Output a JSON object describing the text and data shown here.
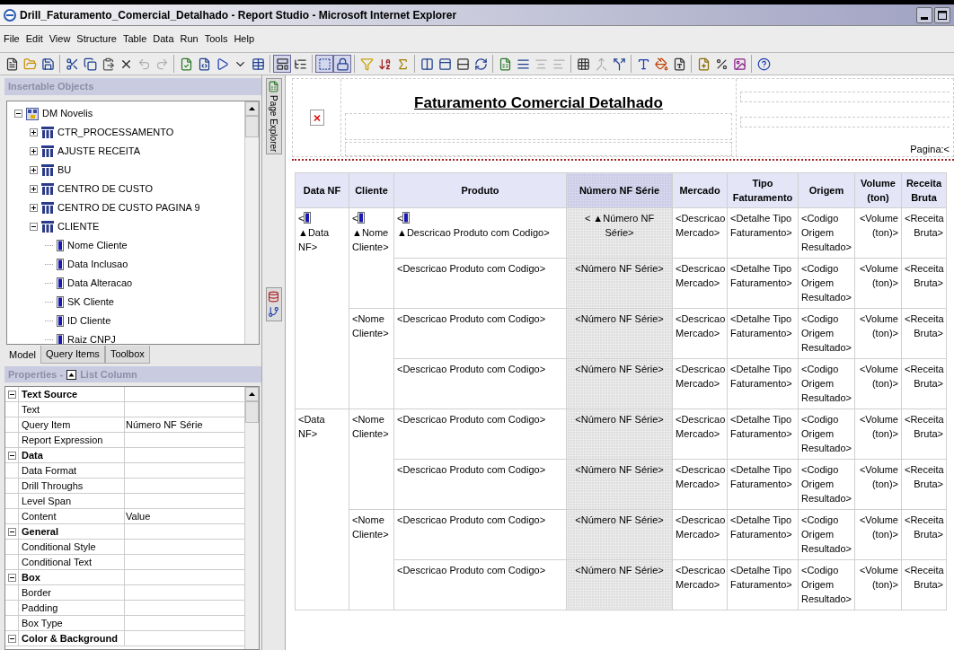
{
  "window": {
    "title": "Drill_Faturamento_Comercial_Detalhado - Report Studio - Microsoft Internet Explorer"
  },
  "menu": [
    "File",
    "Edit",
    "View",
    "Structure",
    "Table",
    "Data",
    "Run",
    "Tools",
    "Help"
  ],
  "toolbar": [
    [
      {
        "pressed": false,
        "disabled": false
      },
      {
        "pressed": false,
        "disabled": false
      },
      {
        "pressed": false,
        "disabled": false
      }
    ],
    [
      {
        "pressed": false,
        "disabled": false
      },
      {
        "pressed": false,
        "disabled": false
      },
      {
        "pressed": false,
        "disabled": false
      },
      {
        "pressed": false,
        "disabled": false
      },
      {
        "pressed": false,
        "disabled": true
      },
      {
        "pressed": false,
        "disabled": true
      }
    ],
    [
      {
        "pressed": false,
        "disabled": false
      },
      {
        "pressed": false,
        "disabled": false
      },
      {
        "pressed": false,
        "disabled": false
      },
      {
        "pressed": false,
        "disabled": false
      },
      {
        "pressed": false,
        "disabled": false
      }
    ],
    [
      {
        "pressed": true,
        "disabled": false
      },
      {
        "pressed": false,
        "disabled": false
      }
    ],
    [
      {
        "pressed": true,
        "disabled": false
      },
      {
        "pressed": true,
        "disabled": false
      }
    ],
    [
      {
        "pressed": false,
        "disabled": false
      },
      {
        "pressed": false,
        "disabled": false
      },
      {
        "pressed": false,
        "disabled": false
      }
    ],
    [
      {
        "pressed": false,
        "disabled": false
      },
      {
        "pressed": false,
        "disabled": false
      },
      {
        "pressed": false,
        "disabled": false
      },
      {
        "pressed": false,
        "disabled": false
      }
    ],
    [
      {
        "pressed": false,
        "disabled": false
      },
      {
        "pressed": false,
        "disabled": false
      },
      {
        "pressed": false,
        "disabled": true
      },
      {
        "pressed": false,
        "disabled": true
      }
    ],
    [
      {
        "pressed": false,
        "disabled": false
      },
      {
        "pressed": false,
        "disabled": true
      },
      {
        "pressed": false,
        "disabled": false
      }
    ],
    [
      {
        "pressed": false,
        "disabled": false
      },
      {
        "pressed": false,
        "disabled": false
      },
      {
        "pressed": false,
        "disabled": false
      }
    ],
    [
      {
        "pressed": false,
        "disabled": false
      },
      {
        "pressed": false,
        "disabled": false
      },
      {
        "pressed": false,
        "disabled": false
      }
    ],
    [
      {
        "pressed": false,
        "disabled": false
      }
    ]
  ],
  "insertable_objects": {
    "title": "Insertable Objects",
    "tree": [
      {
        "label": "DM Novelis",
        "kind": "package",
        "expanded": true,
        "children": [
          {
            "label": "CTR_PROCESSAMENTO",
            "kind": "query_subject",
            "expanded": false
          },
          {
            "label": "AJUSTE RECEITA",
            "kind": "query_subject",
            "expanded": false
          },
          {
            "label": "BU",
            "kind": "query_subject",
            "expanded": false
          },
          {
            "label": "CENTRO DE CUSTO",
            "kind": "query_subject",
            "expanded": false
          },
          {
            "label": "CENTRO DE CUSTO PAGINA 9",
            "kind": "query_subject",
            "expanded": false
          },
          {
            "label": "CLIENTE",
            "kind": "query_subject",
            "expanded": true,
            "children": [
              {
                "label": "Nome Cliente",
                "kind": "query_item"
              },
              {
                "label": "Data Inclusao",
                "kind": "query_item"
              },
              {
                "label": "Data Alteracao",
                "kind": "query_item"
              },
              {
                "label": "SK Cliente",
                "kind": "query_item"
              },
              {
                "label": "ID Cliente",
                "kind": "query_item"
              },
              {
                "label": "Raiz CNPJ",
                "kind": "query_item"
              }
            ]
          }
        ]
      }
    ]
  },
  "tabs": [
    {
      "label": "Model",
      "selected": true
    },
    {
      "label": "Query Items",
      "selected": false
    },
    {
      "label": "Toolbox",
      "selected": false
    }
  ],
  "properties": {
    "title": "Properties -",
    "object": "List Column",
    "groups": [
      {
        "name": "Text Source",
        "expanded": true,
        "rows": [
          {
            "name": "Text"
          },
          {
            "name": "Query Item",
            "value": "Número NF Série"
          },
          {
            "name": "Report Expression"
          }
        ]
      },
      {
        "name": "Data",
        "expanded": true,
        "rows": [
          {
            "name": "Data Format"
          },
          {
            "name": "Drill Throughs"
          },
          {
            "name": "Level Span"
          },
          {
            "name": "Content",
            "value": "Value"
          }
        ]
      },
      {
        "name": "General",
        "expanded": true,
        "rows": [
          {
            "name": "Conditional Style"
          },
          {
            "name": "Conditional Text"
          }
        ]
      },
      {
        "name": "Box",
        "expanded": true,
        "rows": [
          {
            "name": "Border"
          },
          {
            "name": "Padding"
          },
          {
            "name": "Box Type"
          }
        ]
      },
      {
        "name": "Color & Background",
        "expanded": true
      }
    ]
  },
  "page_explorer": {
    "label": "Page Explorer"
  },
  "report": {
    "title": "Faturamento Comercial Detalhado",
    "page_label": "Pagina:<",
    "columns": [
      {
        "label": "Data NF",
        "selected": false
      },
      {
        "label": "Cliente",
        "selected": false
      },
      {
        "label": "Produto",
        "selected": false
      },
      {
        "label": "Número NF Série",
        "selected": true
      },
      {
        "label": "Mercado",
        "selected": false
      },
      {
        "label": "Tipo Faturamento",
        "selected": false
      },
      {
        "label": "Origem",
        "selected": false
      },
      {
        "label": "Volume (ton)",
        "selected": false
      },
      {
        "label": "Receita Bruta",
        "selected": false
      }
    ],
    "groups": [
      {
        "date": {
          "lead": "<",
          "item_icon": true,
          "text": "▲Data NF>"
        },
        "clientes": [
          {
            "cliente": {
              "lead": "<",
              "item_icon": true,
              "text": "▲Nome Cliente>"
            },
            "rows": [
              {
                "cells": [
                  {
                    "lead": "<",
                    "item_icon": true,
                    "text": "▲Descricao Produto com Codigo>"
                  },
                  "< ▲Número NF Série>",
                  "<Descricao Mercado>",
                  "<Detalhe Tipo Faturamento>",
                  "<Codigo Origem Resultado>",
                  "<Volume (ton)>",
                  "<Receita Bruta>"
                ]
              },
              {
                "cells": [
                  "<Descricao Produto com Codigo>",
                  "<Número NF Série>",
                  "<Descricao Mercado>",
                  "<Detalhe Tipo Faturamento>",
                  "<Codigo Origem Resultado>",
                  "<Volume (ton)>",
                  "<Receita Bruta>"
                ]
              }
            ]
          },
          {
            "cliente": "<Nome Cliente>",
            "rows": [
              {
                "cells": [
                  "<Descricao Produto com Codigo>",
                  "<Número NF Série>",
                  "<Descricao Mercado>",
                  "<Detalhe Tipo Faturamento>",
                  "<Codigo Origem Resultado>",
                  "<Volume (ton)>",
                  "<Receita Bruta>"
                ]
              },
              {
                "cells": [
                  "<Descricao Produto com Codigo>",
                  "<Número NF Série>",
                  "<Descricao Mercado>",
                  "<Detalhe Tipo Faturamento>",
                  "<Codigo Origem Resultado>",
                  "<Volume (ton)>",
                  "<Receita Bruta>"
                ]
              }
            ]
          }
        ]
      },
      {
        "date": "<Data NF>",
        "clientes": [
          {
            "cliente": "<Nome Cliente>",
            "rows": [
              {
                "cells": [
                  "<Descricao Produto com Codigo>",
                  "<Número NF Série>",
                  "<Descricao Mercado>",
                  "<Detalhe Tipo Faturamento>",
                  "<Codigo Origem Resultado>",
                  "<Volume (ton)>",
                  "<Receita Bruta>"
                ]
              },
              {
                "cells": [
                  "<Descricao Produto com Codigo>",
                  "<Número NF Série>",
                  "<Descricao Mercado>",
                  "<Detalhe Tipo Faturamento>",
                  "<Codigo Origem Resultado>",
                  "<Volume (ton)>",
                  "<Receita Bruta>"
                ]
              }
            ]
          },
          {
            "cliente": "<Nome Cliente>",
            "rows": [
              {
                "cells": [
                  "<Descricao Produto com Codigo>",
                  "<Número NF Série>",
                  "<Descricao Mercado>",
                  "<Detalhe Tipo Faturamento>",
                  "<Codigo Origem Resultado>",
                  "<Volume (ton)>",
                  "<Receita Bruta>"
                ]
              },
              {
                "cells": [
                  "<Descricao Produto com Codigo>",
                  "<Número NF Série>",
                  "<Descricao Mercado>",
                  "<Detalhe Tipo Faturamento>",
                  "<Codigo Origem Resultado>",
                  "<Volume (ton)>",
                  "<Receita Bruta>"
                ]
              }
            ]
          }
        ]
      }
    ]
  }
}
